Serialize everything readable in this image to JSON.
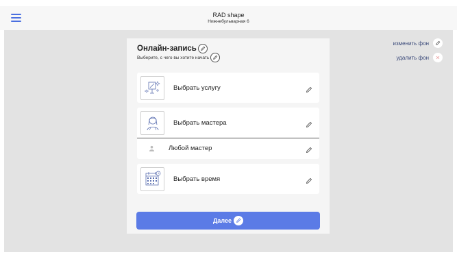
{
  "header": {
    "brand_name": "RAD shape",
    "address": "Нижнебульварная 6"
  },
  "side_actions": {
    "change_bg": "изменить фон",
    "remove_bg": "удалить фон"
  },
  "card": {
    "title": "Онлайн-запись",
    "subtitle": "Выберите, с чего вы хотите начать",
    "tiles": [
      {
        "label": "Выбрать услугу",
        "icon": "service-icon"
      },
      {
        "label": "Выбрать мастера",
        "icon": "master-icon"
      },
      {
        "label": "Любой мастер",
        "icon": "person-icon"
      },
      {
        "label": "Выбрать время",
        "icon": "calendar-icon"
      }
    ],
    "next_label": "Далее"
  },
  "colors": {
    "accent": "#5b7be6",
    "menu": "#4a6fe0",
    "stage": "#e3e3e3"
  }
}
